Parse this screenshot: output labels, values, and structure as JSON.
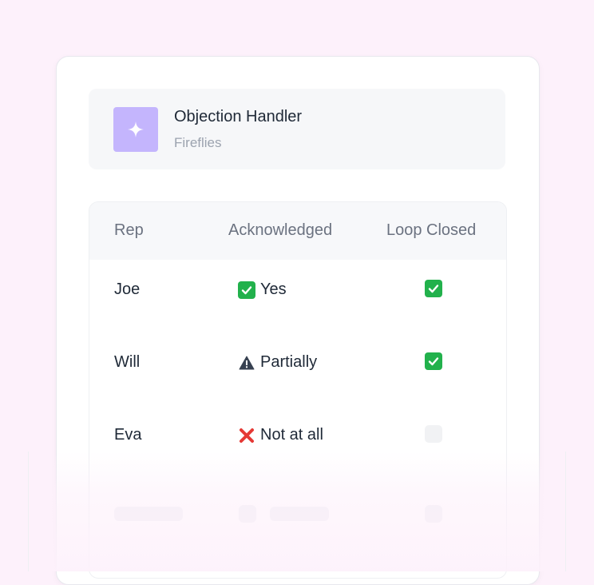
{
  "card": {
    "title": "Objection Handler",
    "subtitle": "Fireflies",
    "icon": "sparkle-icon",
    "icon_bg": "#c4b5fd"
  },
  "table": {
    "headers": [
      "Rep",
      "Acknowledged",
      "Loop Closed"
    ],
    "rows": [
      {
        "rep": "Joe",
        "ack_icon": "check-box-icon",
        "ack_label": "Yes",
        "loop_closed": true
      },
      {
        "rep": "Will",
        "ack_icon": "warning-icon",
        "ack_label": "Partially",
        "loop_closed": true
      },
      {
        "rep": "Eva",
        "ack_icon": "cross-icon",
        "ack_label": "Not at all",
        "loop_closed": false
      }
    ]
  },
  "colors": {
    "background": "#fdf1fb",
    "check_green": "#22b14c",
    "cross_red": "#e53935"
  }
}
